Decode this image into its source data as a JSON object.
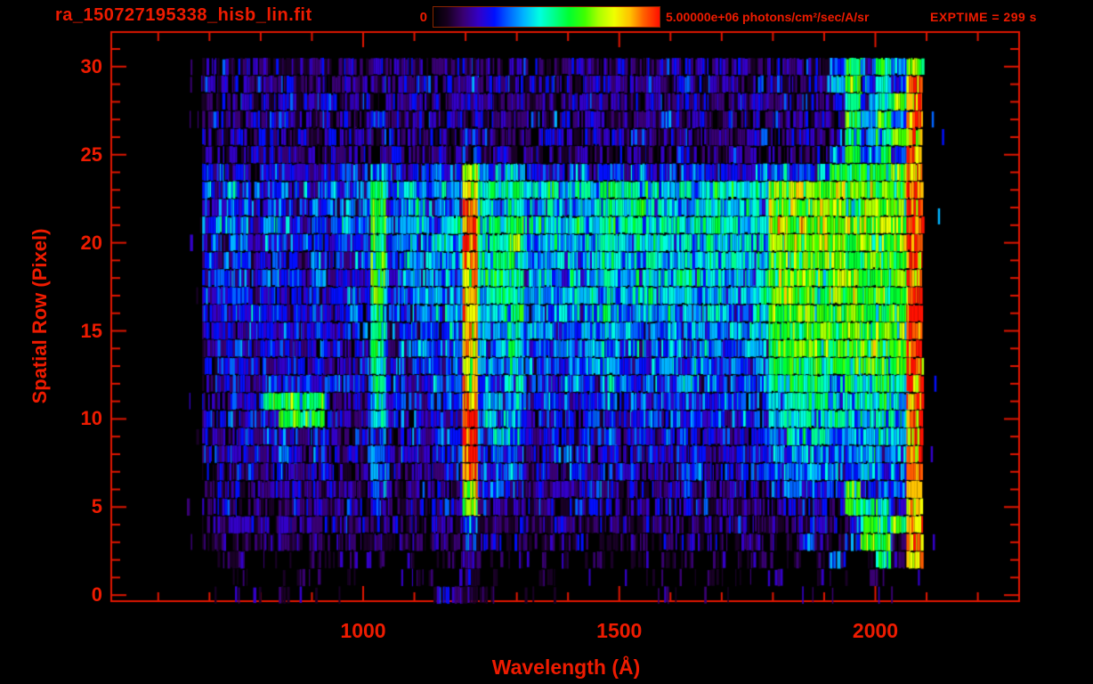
{
  "header": {
    "filename": "ra_150727195338_hisb_lin.fit",
    "exptime_label": "EXPTIME = 299 s"
  },
  "colorbar": {
    "min_label": "0",
    "max_label": "5.00000e+06 photons/cm²/sec/A/sr",
    "min_value": 0,
    "max_value": 5000000,
    "units": "photons/cm²/sec/A/sr"
  },
  "palette": {
    "background": "#000000",
    "text_red": "#ee1b00",
    "axis_red": "#e01600",
    "colorbar_border": "#8a2400",
    "colormap": [
      [
        0.0,
        "#000000"
      ],
      [
        0.06,
        "#16001e"
      ],
      [
        0.13,
        "#38006e"
      ],
      [
        0.2,
        "#3300c8"
      ],
      [
        0.27,
        "#0010ff"
      ],
      [
        0.33,
        "#0060ff"
      ],
      [
        0.4,
        "#00b4ff"
      ],
      [
        0.47,
        "#00ffe0"
      ],
      [
        0.53,
        "#00ff90"
      ],
      [
        0.6,
        "#00ff30"
      ],
      [
        0.67,
        "#40ff00"
      ],
      [
        0.73,
        "#a8ff00"
      ],
      [
        0.8,
        "#f0ff00"
      ],
      [
        0.87,
        "#ffc000"
      ],
      [
        0.93,
        "#ff6000"
      ],
      [
        1.0,
        "#ff1000"
      ]
    ]
  },
  "chart_data": {
    "type": "heatmap",
    "title": "ra_150727195338_hisb_lin.fit",
    "xlabel": "Wavelength (Å)",
    "ylabel": "Spatial Row (Pixel)",
    "x_range": [
      508,
      2272
    ],
    "x_ticks_major": [
      1000,
      1500,
      2000
    ],
    "x_minor_step": 100,
    "y_range": [
      -0.35,
      32.3
    ],
    "y_ticks_major": [
      0,
      5,
      10,
      15,
      20,
      25,
      30
    ],
    "y_minor_step": 1,
    "value_min": 0,
    "value_max": 5000000,
    "intensity_levels": 16,
    "wavelength_start": 660,
    "wavelength_bin": 29.9,
    "row_top": 30,
    "row_bottom": 0,
    "emission_lines_A": [
      1025,
      1216,
      1305,
      1480,
      2075
    ],
    "rows_top_to_bottom": [
      [
        "023323323232",
        "3",
        "23232",
        "3",
        "22",
        "3",
        "32232",
        "2",
        "3223232232",
        "23325a686",
        "b"
      ],
      [
        "033233423232",
        "3",
        "32423",
        "4",
        "23",
        "3",
        "23324",
        "3",
        "2332423223",
        "32246a585",
        "f"
      ],
      [
        "023323323423",
        "2",
        "33233",
        "4",
        "32",
        "4",
        "23233",
        "3",
        "3242332233",
        "23335968a",
        "e"
      ],
      [
        "032233423232",
        "4",
        "23323",
        "3",
        "23",
        "3",
        "32423",
        "2",
        "2334232332",
        "32243a695",
        "e"
      ],
      [
        "023323232423",
        "3",
        "32232",
        "4",
        "32",
        "3",
        "23323",
        "3",
        "2423323223",
        "23324968b",
        "e"
      ],
      [
        "022332232332",
        "2",
        "32232",
        "3",
        "23",
        "2",
        "32232",
        "2",
        "2322322322",
        "22235a585",
        "e"
      ],
      [
        "044434443444",
        "6",
        "44454",
        "b",
        "66",
        "6",
        "45454",
        "5",
        "4545454545",
        "5656a9aab",
        "f"
      ],
      [
        "055645564556",
        "9",
        "67676",
        "c",
        "88",
        "9",
        "78787",
        "9",
        "8887878887",
        "bcbbcbcbb",
        "f"
      ],
      [
        "045545545455",
        "a",
        "56766",
        "f",
        "87",
        "8",
        "67677",
        "8",
        "7877678777",
        "bbabbabba",
        "f"
      ],
      [
        "056546545565",
        "a",
        "67767",
        "f",
        "98",
        "a",
        "78787",
        "9",
        "8878788878",
        "cbcbbcbcb",
        "f"
      ],
      [
        "045545455454",
        "9",
        "56676",
        "e",
        "88",
        "a",
        "67767",
        "8",
        "7787877787",
        "bcbbbabbb",
        "f"
      ],
      [
        "044544545445",
        "9",
        "56666",
        "e",
        "78",
        "8",
        "66767",
        "8",
        "7687767877",
        "babbbabab",
        "f"
      ],
      [
        "045445445444",
        "a",
        "56666",
        "d",
        "88",
        "9",
        "67676",
        "8",
        "7777877677",
        "bababbaab",
        "f"
      ],
      [
        "044544454454",
        "9",
        "55666",
        "d",
        "78",
        "8",
        "66667",
        "7",
        "6777767777",
        "abaabbaba",
        "f"
      ],
      [
        "044454445444",
        "8",
        "55566",
        "d",
        "77",
        "8",
        "56666",
        "7",
        "6667766677",
        "aabaabaab",
        "f"
      ],
      [
        "044444544444",
        "8",
        "45556",
        "e",
        "67",
        "7",
        "56566",
        "7",
        "6566676667",
        "aaabaaaba",
        "f"
      ],
      [
        "034444444434",
        "9",
        "45555",
        "d",
        "67",
        "8",
        "55656",
        "6",
        "5656666566",
        "aabaaabaa",
        "f"
      ],
      [
        "034443444344",
        "8",
        "44555",
        "d",
        "66",
        "7",
        "55556",
        "6",
        "5556565656",
        "9a9aa9a9a",
        "f"
      ],
      [
        "034434443443",
        "8",
        "44455",
        "d",
        "66",
        "7",
        "45555",
        "6",
        "5455656556",
        "899989898",
        "f"
      ],
      [
        "03444aa9a434",
        "7",
        "44445",
        "e",
        "66",
        "6",
        "45545",
        "5",
        "4545554545",
        "788878887",
        "f"
      ],
      [
        "034445aa9434",
        "7",
        "44444",
        "f",
        "66",
        "6",
        "44545",
        "5",
        "4454545454",
        "778787787",
        "f"
      ],
      [
        "033434434334",
        "6",
        "34444",
        "f",
        "56",
        "6",
        "44444",
        "5",
        "4444544444",
        "677767677",
        "f"
      ],
      [
        "033433434333",
        "6",
        "34344",
        "f",
        "55",
        "5",
        "34444",
        "4",
        "3444443444",
        "667666766",
        "f"
      ],
      [
        "023333433323",
        "6",
        "33344",
        "e",
        "45",
        "5",
        "34343",
        "4",
        "3343443434",
        "566656656",
        "e"
      ],
      [
        "023233332332",
        "5",
        "23333",
        "d",
        "44",
        "4",
        "33334",
        "4",
        "3333433333",
        "45554a455",
        "e"
      ],
      [
        "023232332232",
        "4",
        "23233",
        "b",
        "34",
        "3",
        "23233",
        "3",
        "2323332323",
        "34443a794",
        "e"
      ],
      [
        "022322322232",
        "3",
        "22232",
        "5",
        "23",
        "2",
        "22322",
        "2",
        "2232232232",
        "233324a9a",
        "e"
      ],
      [
        "011212212121",
        "2",
        "12121",
        "4",
        "22",
        "2",
        "12121",
        "1",
        "1212212121",
        "125215a92",
        "e"
      ],
      [
        "001101101110",
        "1",
        "01011",
        "3",
        "11",
        "1",
        "01101",
        "1",
        "0101101011",
        "010140192",
        "d"
      ],
      [
        "000100010010",
        "0",
        "00100",
        "2",
        "00",
        "0",
        "01000",
        "0",
        "0010001000",
        "000100010",
        "0"
      ],
      [
        "000000100000",
        "0",
        "00033",
        "2",
        "10",
        "0",
        "00000",
        "0",
        "0001000000",
        "000000000",
        "0"
      ]
    ],
    "stray_specks": [
      {
        "row": 27,
        "wl": 2110,
        "v": 5
      },
      {
        "row": 26,
        "wl": 2130,
        "v": 4
      },
      {
        "row": 21.5,
        "wl": 2122,
        "v": 6
      },
      {
        "row": 12,
        "wl": 2115,
        "v": 4
      },
      {
        "row": 8,
        "wl": 2108,
        "v": 3
      },
      {
        "row": 3,
        "wl": 2112,
        "v": 3
      }
    ],
    "legend_position": "top",
    "grid": "off"
  }
}
